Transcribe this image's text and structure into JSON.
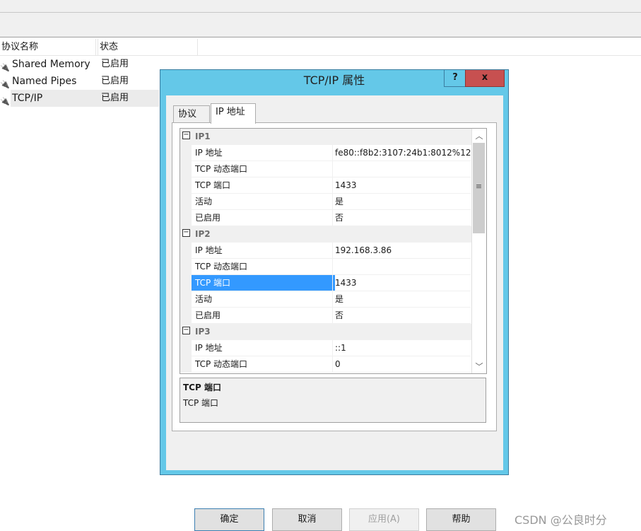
{
  "list": {
    "headers": [
      "协议名称",
      "状态"
    ],
    "rows": [
      {
        "name": "Shared Memory",
        "status": "已启用"
      },
      {
        "name": "Named Pipes",
        "status": "已启用"
      },
      {
        "name": "TCP/IP",
        "status": "已启用"
      }
    ]
  },
  "dialog": {
    "title": "TCP/IP 属性",
    "help": "?",
    "close": "x",
    "tabs": [
      "协议",
      "IP 地址"
    ],
    "active_tab": 1,
    "grid": [
      {
        "cat": "IP1"
      },
      {
        "k": "IP 地址",
        "v": "fe80::f8b2:3107:24b1:8012%12"
      },
      {
        "k": "TCP 动态端口",
        "v": ""
      },
      {
        "k": "TCP 端口",
        "v": "1433"
      },
      {
        "k": "活动",
        "v": "是"
      },
      {
        "k": "已启用",
        "v": "否"
      },
      {
        "cat": "IP2"
      },
      {
        "k": "IP 地址",
        "v": "192.168.3.86"
      },
      {
        "k": "TCP 动态端口",
        "v": ""
      },
      {
        "k": "TCP 端口",
        "v": "1433",
        "selected": true
      },
      {
        "k": "活动",
        "v": "是"
      },
      {
        "k": "已启用",
        "v": "否"
      },
      {
        "cat": "IP3"
      },
      {
        "k": "IP 地址",
        "v": "::1"
      },
      {
        "k": "TCP 动态端口",
        "v": "0"
      }
    ],
    "desc_title": "TCP 端口",
    "desc_text": "TCP 端口",
    "buttons": {
      "ok": "确定",
      "cancel": "取消",
      "apply": "应用(A)",
      "help": "帮助"
    }
  },
  "watermark": "CSDN @公良时分",
  "colors": {
    "title_bar": "#64c8e8",
    "close": "#c75050",
    "selection": "#3399ff"
  }
}
